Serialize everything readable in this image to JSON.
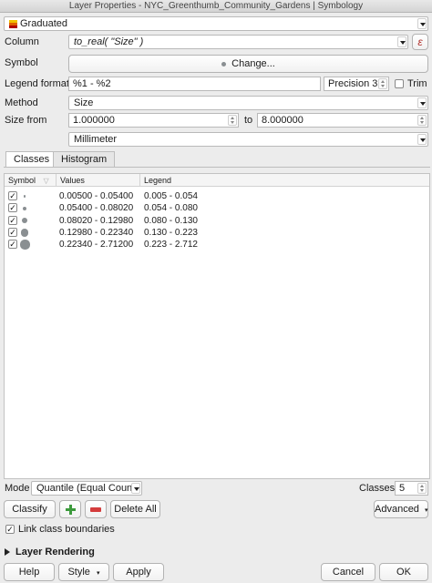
{
  "window": {
    "title": "Layer Properties - NYC_Greenthumb_Community_Gardens | Symbology"
  },
  "renderer": {
    "value": "Graduated"
  },
  "column": {
    "label": "Column",
    "value": "to_real( \"Size\" )",
    "expr_icon": "ε"
  },
  "symbol": {
    "label": "Symbol",
    "button": "Change..."
  },
  "legend_format": {
    "label": "Legend format",
    "value": "%1 - %2",
    "precision_label": "Precision 3",
    "trim_label": "Trim"
  },
  "method": {
    "label": "Method",
    "value": "Size"
  },
  "size": {
    "from_label": "Size from",
    "from_value": "1.000000",
    "to_label": "to",
    "to_value": "8.000000",
    "unit": "Millimeter"
  },
  "tabs": [
    {
      "label": "Classes",
      "active": true
    },
    {
      "label": "Histogram",
      "active": false
    }
  ],
  "table": {
    "headers": [
      "Symbol",
      "Values",
      "Legend"
    ],
    "symbol_color": "#8a8f92",
    "rows": [
      {
        "checked": true,
        "values": "0.00500 - 0.05400",
        "legend": "0.005 - 0.054",
        "size": 1.0
      },
      {
        "checked": true,
        "values": "0.05400 - 0.08020",
        "legend": "0.054 - 0.080",
        "size": 2.75
      },
      {
        "checked": true,
        "values": "0.08020 - 0.12980",
        "legend": "0.080 - 0.130",
        "size": 4.5
      },
      {
        "checked": true,
        "values": "0.12980 - 0.22340",
        "legend": "0.130 - 0.223",
        "size": 6.25
      },
      {
        "checked": true,
        "values": "0.22340 - 2.71200",
        "legend": "0.223 - 2.712",
        "size": 8.0
      }
    ]
  },
  "mode": {
    "label": "Mode",
    "value": "Quantile (Equal Count)",
    "classes_label": "Classes",
    "classes_value": "5"
  },
  "actions": {
    "classify": "Classify",
    "delete_all": "Delete All",
    "advanced": "Advanced"
  },
  "link_boundaries": {
    "label": "Link class boundaries",
    "checked": true
  },
  "layer_rendering": {
    "label": "Layer Rendering"
  },
  "footer": {
    "help": "Help",
    "style": "Style",
    "apply": "Apply",
    "cancel": "Cancel",
    "ok": "OK"
  }
}
